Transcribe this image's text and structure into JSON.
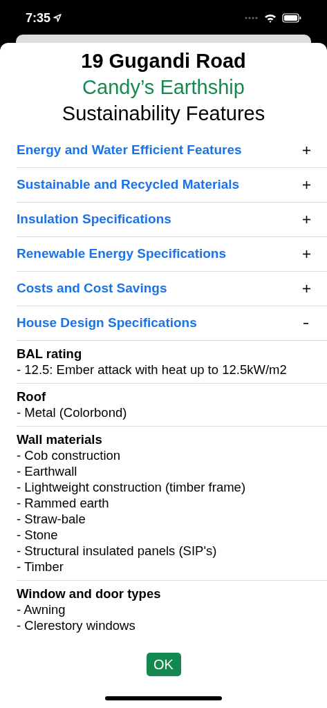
{
  "status_bar": {
    "time": "7:35"
  },
  "header": {
    "title": "19 Gugandi Road",
    "subtitle": "Candy’s Earthship",
    "heading": "Sustainability Features"
  },
  "sections": [
    {
      "title": "Energy and Water Efficient Features",
      "expanded": false
    },
    {
      "title": "Sustainable and Recycled Materials",
      "expanded": false
    },
    {
      "title": "Insulation Specifications",
      "expanded": false
    },
    {
      "title": "Renewable Energy Specifications",
      "expanded": false
    },
    {
      "title": "Costs and Cost Savings",
      "expanded": false
    },
    {
      "title": "House Design Specifications",
      "expanded": true,
      "groups": [
        {
          "heading": "BAL rating",
          "lines": [
            "- 12.5: Ember attack with heat up to 12.5kW/m2"
          ]
        },
        {
          "heading": "Roof",
          "lines": [
            "- Metal (Colorbond)"
          ]
        },
        {
          "heading": "Wall materials",
          "lines": [
            "- Cob construction",
            "- Earthwall",
            "- Lightweight construction (timber frame)",
            "- Rammed earth",
            "- Straw-bale",
            "- Stone",
            "- Structural insulated panels (SIP's)",
            "- Timber"
          ]
        },
        {
          "heading": "Window and door types",
          "lines": [
            "- Awning",
            "- Clerestory windows"
          ]
        }
      ]
    }
  ],
  "ok_button": "OK"
}
